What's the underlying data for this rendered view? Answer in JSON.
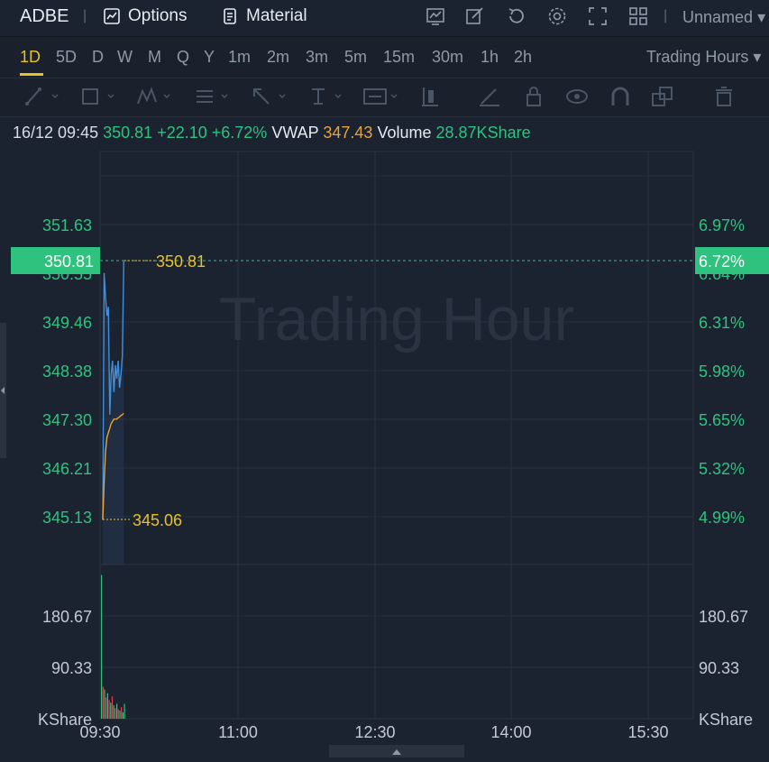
{
  "header": {
    "symbol": "ADBE",
    "options_label": "Options",
    "material_label": "Material",
    "separator": "|",
    "layout_name": "Unnamed",
    "layout_caret": "▾"
  },
  "timeframes": {
    "items": [
      "1D",
      "5D",
      "D",
      "W",
      "M",
      "Q",
      "Y",
      "1m",
      "2m",
      "3m",
      "5m",
      "15m",
      "30m",
      "1h",
      "2h"
    ],
    "active": "1D",
    "session_label": "Trading Hours",
    "session_caret": "▾"
  },
  "info": {
    "time": "16/12 09:45",
    "price": "350.81",
    "change": "+22.10",
    "change_pct": "+6.72%",
    "vwap_label": "VWAP",
    "vwap_value": "347.43",
    "volume_label": "Volume",
    "volume_value": "28.87KShare"
  },
  "chart": {
    "watermark": "Trading Hour",
    "current_price_tag": "350.81",
    "current_pct_tag": "6.72%",
    "high_label": "350.81",
    "low_label": "345.06",
    "hidden_tick": "350.55",
    "hidden_tick_pct": "6.64%",
    "price_ticks": [
      "351.63",
      "349.46",
      "348.38",
      "347.30",
      "346.21",
      "345.13"
    ],
    "pct_ticks": [
      "6.97%",
      "6.31%",
      "5.98%",
      "5.65%",
      "5.32%",
      "4.99%"
    ],
    "volume_ticks": [
      "180.67",
      "90.33"
    ],
    "volume_unit": "KShare",
    "time_ticks": [
      "09:30",
      "11:00",
      "12:30",
      "14:00",
      "15:30"
    ],
    "colors": {
      "background": "#1c2330",
      "price_line": "#3d8fe0",
      "vwap_line": "#e8a33c",
      "up": "#2ec27e",
      "down": "#e0414e",
      "price_tag": "#2ec27e",
      "marker_text": "#e6c229"
    }
  },
  "chart_data": {
    "type": "line",
    "x_axis": "time",
    "x_ticks": [
      "09:30",
      "11:00",
      "12:30",
      "14:00",
      "15:30"
    ],
    "ylim": [
      344.6,
      352.5
    ],
    "series": [
      {
        "values": [
          {
            "t": "09:30",
            "v": 345.06
          },
          {
            "t": "09:31",
            "v": 350.55
          },
          {
            "t": "09:32",
            "v": 350.0
          },
          {
            "t": "09:33",
            "v": 349.6
          },
          {
            "t": "09:34",
            "v": 349.8
          },
          {
            "t": "09:35",
            "v": 347.4
          },
          {
            "t": "09:36",
            "v": 348.3
          },
          {
            "t": "09:37",
            "v": 348.6
          },
          {
            "t": "09:38",
            "v": 347.9
          },
          {
            "t": "09:39",
            "v": 348.5
          },
          {
            "t": "09:40",
            "v": 348.2
          },
          {
            "t": "09:41",
            "v": 348.6
          },
          {
            "t": "09:42",
            "v": 348.0
          },
          {
            "t": "09:43",
            "v": 348.3
          },
          {
            "t": "09:44",
            "v": 348.7
          },
          {
            "t": "09:45",
            "v": 350.81
          }
        ]
      },
      {
        "name": "VWAP",
        "values": [
          {
            "t": "09:30",
            "v": 345.06
          },
          {
            "t": "09:31",
            "v": 345.9
          },
          {
            "t": "09:32",
            "v": 346.6
          },
          {
            "t": "09:33",
            "v": 346.9
          },
          {
            "t": "09:34",
            "v": 347.0
          },
          {
            "t": "09:35",
            "v": 347.1
          },
          {
            "t": "09:36",
            "v": 347.2
          },
          {
            "t": "09:37",
            "v": 347.25
          },
          {
            "t": "09:38",
            "v": 347.3
          },
          {
            "t": "09:39",
            "v": 347.3
          },
          {
            "t": "09:40",
            "v": 347.3
          },
          {
            "t": "09:41",
            "v": 347.33
          },
          {
            "t": "09:42",
            "v": 347.35
          },
          {
            "t": "09:43",
            "v": 347.38
          },
          {
            "t": "09:44",
            "v": 347.4
          },
          {
            "t": "09:45",
            "v": 347.43
          }
        ]
      }
    ],
    "volume": {
      "unit": "KShare",
      "ylim": [
        0,
        271
      ],
      "bars": [
        {
          "t": "09:30",
          "v": 270,
          "dir": "up"
        },
        {
          "t": "09:31",
          "v": 60,
          "dir": "down"
        },
        {
          "t": "09:32",
          "v": 55,
          "dir": "up"
        },
        {
          "t": "09:33",
          "v": 40,
          "dir": "down"
        },
        {
          "t": "09:34",
          "v": 48,
          "dir": "up"
        },
        {
          "t": "09:35",
          "v": 35,
          "dir": "down"
        },
        {
          "t": "09:36",
          "v": 30,
          "dir": "up"
        },
        {
          "t": "09:37",
          "v": 42,
          "dir": "down"
        },
        {
          "t": "09:38",
          "v": 25,
          "dir": "up"
        },
        {
          "t": "09:39",
          "v": 20,
          "dir": "down"
        },
        {
          "t": "09:40",
          "v": 28,
          "dir": "up"
        },
        {
          "t": "09:41",
          "v": 18,
          "dir": "down"
        },
        {
          "t": "09:42",
          "v": 15,
          "dir": "up"
        },
        {
          "t": "09:43",
          "v": 22,
          "dir": "down"
        },
        {
          "t": "09:44",
          "v": 12,
          "dir": "up"
        },
        {
          "t": "09:45",
          "v": 28,
          "dir": "up"
        }
      ]
    }
  }
}
